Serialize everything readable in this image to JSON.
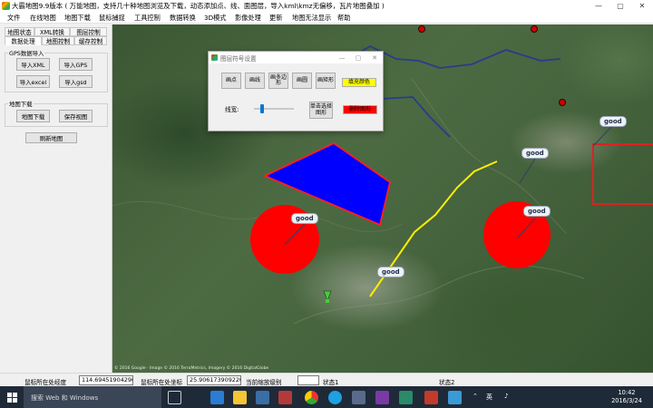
{
  "window": {
    "title": "大霸地图9.9版本 ( 万能地图，支持几十种地图浏览及下载，动态添加点、线、面图层，导入kml\\kmz无偏移，瓦片地图叠加 )",
    "controls": {
      "minimize": "—",
      "maximize": "▢",
      "close": "✕"
    }
  },
  "menu": [
    "文件",
    "在线地图",
    "地图下载",
    "鼠标捕捉",
    "工具控制",
    "数据转换",
    "3D模式",
    "影像处理",
    "更新",
    "地图无法显示",
    "帮助"
  ],
  "left_panel": {
    "tabs_row1": [
      "地图状态",
      "XML转换",
      "图层控制"
    ],
    "tabs_row2": [
      "数据处理",
      "地图控制",
      "缓存控制"
    ],
    "gps_group": {
      "title": "GPS数据导入",
      "buttons": [
        "导入XML",
        "导入GPS",
        "导入excel",
        "导入gsd"
      ]
    },
    "download_group": {
      "title": "地图下载",
      "buttons": [
        "地图下载",
        "保存视图"
      ]
    },
    "refresh_button": "刷新地图"
  },
  "map": {
    "labels": [
      "good",
      "good",
      "good",
      "good",
      "good"
    ],
    "copyright": "© 2016 Google · Image © 2016 TerraMetrics, Imagery © 2016 DigitalGlobe",
    "colors": {
      "polygon_fill": "#0000ff",
      "polygon_stroke": "#ff2020",
      "circle_fill": "#ff0000",
      "polyline": "#ffee00",
      "road": "#283c8c",
      "rect_stroke": "#e02020"
    }
  },
  "dialog": {
    "title": "图层符号设置",
    "buttons": [
      "画点",
      "画线",
      "画多边形",
      "画圆",
      "画矩形"
    ],
    "fill_color_button": "填充颜色",
    "line_width_label": "线宽:",
    "line_width_value": 0.2,
    "single_select_button": "单击选择图形",
    "delete_button": "删除图形",
    "colors": {
      "fill_color": "#ffff00",
      "delete": "#ff0000"
    }
  },
  "status_bar": {
    "lng_label": "鼠标所在处经度",
    "lng_value": "114.694519042969",
    "lat_label": "鼠标所在处坐标",
    "lat_value": "25.9061739092208",
    "zoom_label": "当前缩放级别",
    "zoom_value": "",
    "status1": "状态1",
    "status2": "状态2"
  },
  "taskbar": {
    "search_placeholder": "搜索 Web 和 Windows",
    "tray_ime": "英",
    "time": "10:42",
    "date": "2016/3/24"
  }
}
